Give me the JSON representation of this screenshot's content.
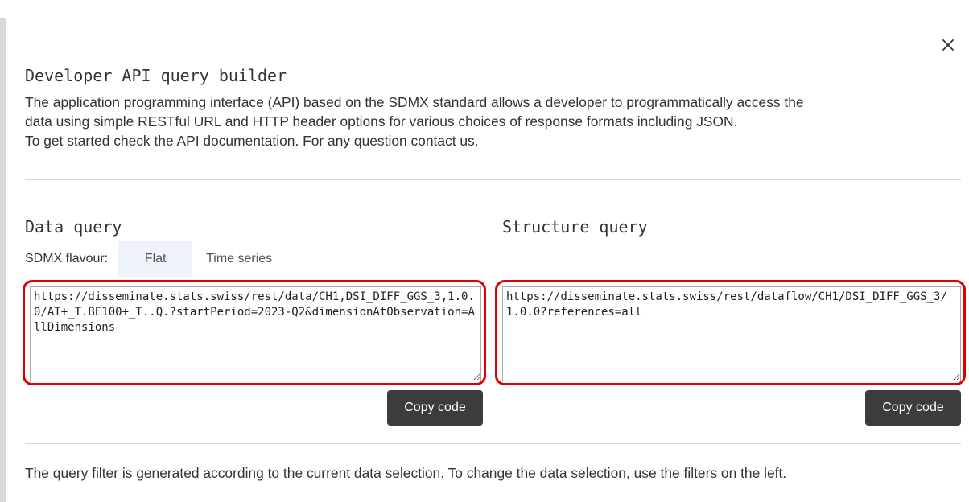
{
  "modal": {
    "title": "Developer API query builder",
    "intro_lines": [
      "The application programming interface (API) based on the SDMX standard allows a developer to programmatically access the",
      "data using simple RESTful URL and HTTP header options for various choices of response formats including JSON.",
      "To get started check the API documentation. For any question contact us."
    ],
    "footer_note": "The query filter is generated according to the current data selection. To change the data selection, use the filters on the left."
  },
  "data_query": {
    "title": "Data query",
    "flavour_label": "SDMX flavour:",
    "flavour_options": [
      "Flat",
      "Time series"
    ],
    "selected_flavour": "Flat",
    "url": "https://disseminate.stats.swiss/rest/data/CH1,DSI_DIFF_GGS_3,1.0.0/AT+_T.BE100+_T..Q.?startPeriod=2023-Q2&dimensionAtObservation=AllDimensions",
    "copy_label": "Copy code"
  },
  "structure_query": {
    "title": "Structure query",
    "url": "https://disseminate.stats.swiss/rest/dataflow/CH1/DSI_DIFF_GGS_3/1.0.0?references=all",
    "copy_label": "Copy code"
  },
  "colors": {
    "highlight": "#e00000",
    "button_bg": "#3c3c3c",
    "active_option_bg": "#eef3fa"
  },
  "icons": {
    "close": "close-icon"
  }
}
